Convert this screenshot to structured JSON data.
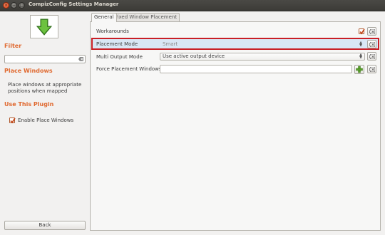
{
  "window": {
    "title": "CompizConfig Settings Manager"
  },
  "sidebar": {
    "filter_heading": "Filter",
    "filter_value": "",
    "plugin_heading": "Place Windows",
    "plugin_description": "Place windows at appropriate positions when mapped",
    "use_heading": "Use This Plugin",
    "enable_label": "Enable Place Windows",
    "enable_checked": true,
    "back_label": "Back"
  },
  "tabs": [
    {
      "label": "General",
      "active": true
    },
    {
      "label": "Fixed Window Placement",
      "active": false
    }
  ],
  "settings": {
    "workarounds": {
      "label": "Workarounds",
      "checked": true
    },
    "placement_mode": {
      "label": "Placement Mode",
      "value": "Smart"
    },
    "multi_output_mode": {
      "label": "Multi Output Mode",
      "value": "Use active output device"
    },
    "force_placement": {
      "label": "Force Placement Windows",
      "value": ""
    }
  },
  "colors": {
    "accent": "#e06a31",
    "highlight_border": "#c91f26",
    "selection": "#d9e7f5",
    "titlebar": "#3c3b37"
  },
  "icons": [
    "close-icon",
    "minimize-icon",
    "maximize-icon",
    "back-arrow-icon",
    "clear-icon",
    "reset-icon",
    "add-icon",
    "checkmark-icon"
  ]
}
